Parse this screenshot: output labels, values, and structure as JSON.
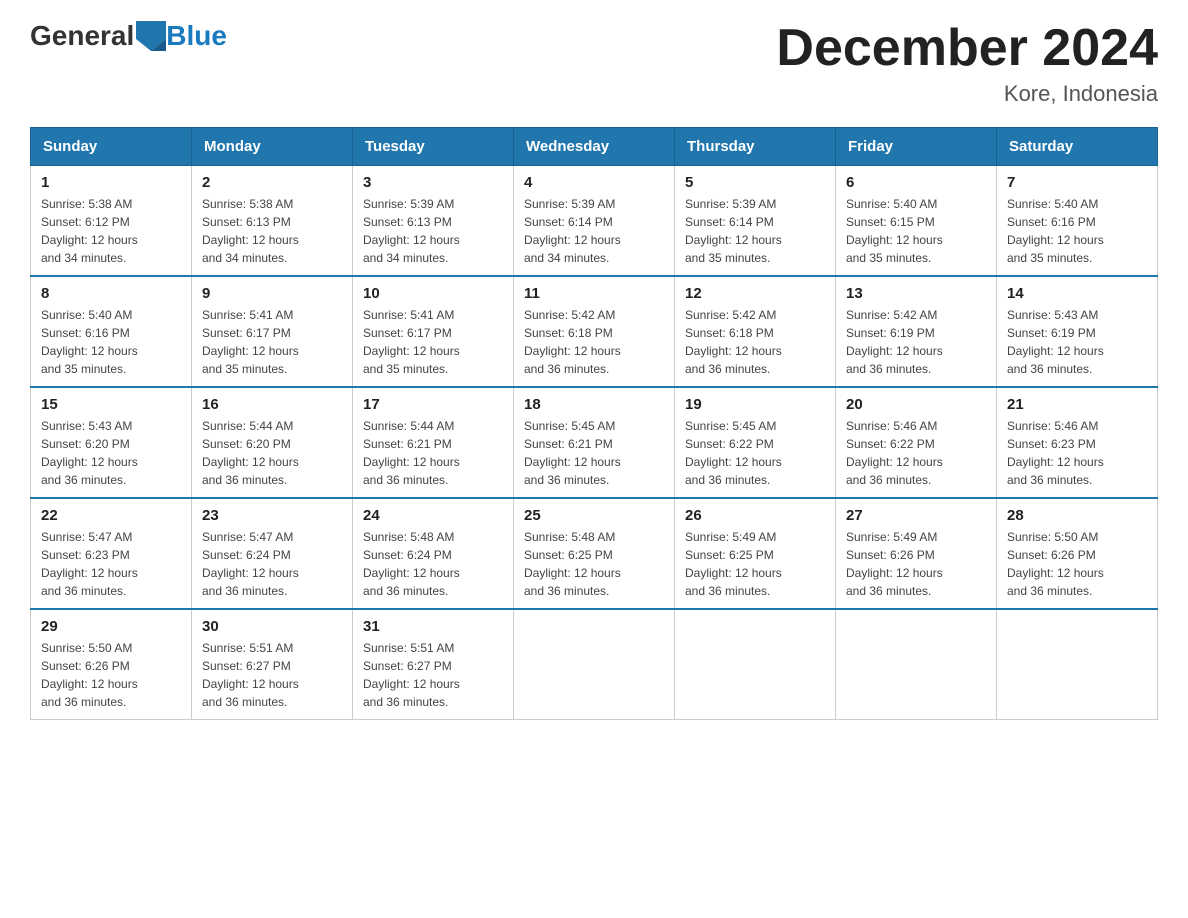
{
  "header": {
    "logo_general": "General",
    "logo_blue": "Blue",
    "month_title": "December 2024",
    "location": "Kore, Indonesia"
  },
  "days_of_week": [
    "Sunday",
    "Monday",
    "Tuesday",
    "Wednesday",
    "Thursday",
    "Friday",
    "Saturday"
  ],
  "weeks": [
    [
      {
        "day": "1",
        "sunrise": "5:38 AM",
        "sunset": "6:12 PM",
        "daylight": "12 hours and 34 minutes."
      },
      {
        "day": "2",
        "sunrise": "5:38 AM",
        "sunset": "6:13 PM",
        "daylight": "12 hours and 34 minutes."
      },
      {
        "day": "3",
        "sunrise": "5:39 AM",
        "sunset": "6:13 PM",
        "daylight": "12 hours and 34 minutes."
      },
      {
        "day": "4",
        "sunrise": "5:39 AM",
        "sunset": "6:14 PM",
        "daylight": "12 hours and 34 minutes."
      },
      {
        "day": "5",
        "sunrise": "5:39 AM",
        "sunset": "6:14 PM",
        "daylight": "12 hours and 35 minutes."
      },
      {
        "day": "6",
        "sunrise": "5:40 AM",
        "sunset": "6:15 PM",
        "daylight": "12 hours and 35 minutes."
      },
      {
        "day": "7",
        "sunrise": "5:40 AM",
        "sunset": "6:16 PM",
        "daylight": "12 hours and 35 minutes."
      }
    ],
    [
      {
        "day": "8",
        "sunrise": "5:40 AM",
        "sunset": "6:16 PM",
        "daylight": "12 hours and 35 minutes."
      },
      {
        "day": "9",
        "sunrise": "5:41 AM",
        "sunset": "6:17 PM",
        "daylight": "12 hours and 35 minutes."
      },
      {
        "day": "10",
        "sunrise": "5:41 AM",
        "sunset": "6:17 PM",
        "daylight": "12 hours and 35 minutes."
      },
      {
        "day": "11",
        "sunrise": "5:42 AM",
        "sunset": "6:18 PM",
        "daylight": "12 hours and 36 minutes."
      },
      {
        "day": "12",
        "sunrise": "5:42 AM",
        "sunset": "6:18 PM",
        "daylight": "12 hours and 36 minutes."
      },
      {
        "day": "13",
        "sunrise": "5:42 AM",
        "sunset": "6:19 PM",
        "daylight": "12 hours and 36 minutes."
      },
      {
        "day": "14",
        "sunrise": "5:43 AM",
        "sunset": "6:19 PM",
        "daylight": "12 hours and 36 minutes."
      }
    ],
    [
      {
        "day": "15",
        "sunrise": "5:43 AM",
        "sunset": "6:20 PM",
        "daylight": "12 hours and 36 minutes."
      },
      {
        "day": "16",
        "sunrise": "5:44 AM",
        "sunset": "6:20 PM",
        "daylight": "12 hours and 36 minutes."
      },
      {
        "day": "17",
        "sunrise": "5:44 AM",
        "sunset": "6:21 PM",
        "daylight": "12 hours and 36 minutes."
      },
      {
        "day": "18",
        "sunrise": "5:45 AM",
        "sunset": "6:21 PM",
        "daylight": "12 hours and 36 minutes."
      },
      {
        "day": "19",
        "sunrise": "5:45 AM",
        "sunset": "6:22 PM",
        "daylight": "12 hours and 36 minutes."
      },
      {
        "day": "20",
        "sunrise": "5:46 AM",
        "sunset": "6:22 PM",
        "daylight": "12 hours and 36 minutes."
      },
      {
        "day": "21",
        "sunrise": "5:46 AM",
        "sunset": "6:23 PM",
        "daylight": "12 hours and 36 minutes."
      }
    ],
    [
      {
        "day": "22",
        "sunrise": "5:47 AM",
        "sunset": "6:23 PM",
        "daylight": "12 hours and 36 minutes."
      },
      {
        "day": "23",
        "sunrise": "5:47 AM",
        "sunset": "6:24 PM",
        "daylight": "12 hours and 36 minutes."
      },
      {
        "day": "24",
        "sunrise": "5:48 AM",
        "sunset": "6:24 PM",
        "daylight": "12 hours and 36 minutes."
      },
      {
        "day": "25",
        "sunrise": "5:48 AM",
        "sunset": "6:25 PM",
        "daylight": "12 hours and 36 minutes."
      },
      {
        "day": "26",
        "sunrise": "5:49 AM",
        "sunset": "6:25 PM",
        "daylight": "12 hours and 36 minutes."
      },
      {
        "day": "27",
        "sunrise": "5:49 AM",
        "sunset": "6:26 PM",
        "daylight": "12 hours and 36 minutes."
      },
      {
        "day": "28",
        "sunrise": "5:50 AM",
        "sunset": "6:26 PM",
        "daylight": "12 hours and 36 minutes."
      }
    ],
    [
      {
        "day": "29",
        "sunrise": "5:50 AM",
        "sunset": "6:26 PM",
        "daylight": "12 hours and 36 minutes."
      },
      {
        "day": "30",
        "sunrise": "5:51 AM",
        "sunset": "6:27 PM",
        "daylight": "12 hours and 36 minutes."
      },
      {
        "day": "31",
        "sunrise": "5:51 AM",
        "sunset": "6:27 PM",
        "daylight": "12 hours and 36 minutes."
      },
      null,
      null,
      null,
      null
    ]
  ],
  "labels": {
    "sunrise": "Sunrise:",
    "sunset": "Sunset:",
    "daylight": "Daylight:"
  }
}
